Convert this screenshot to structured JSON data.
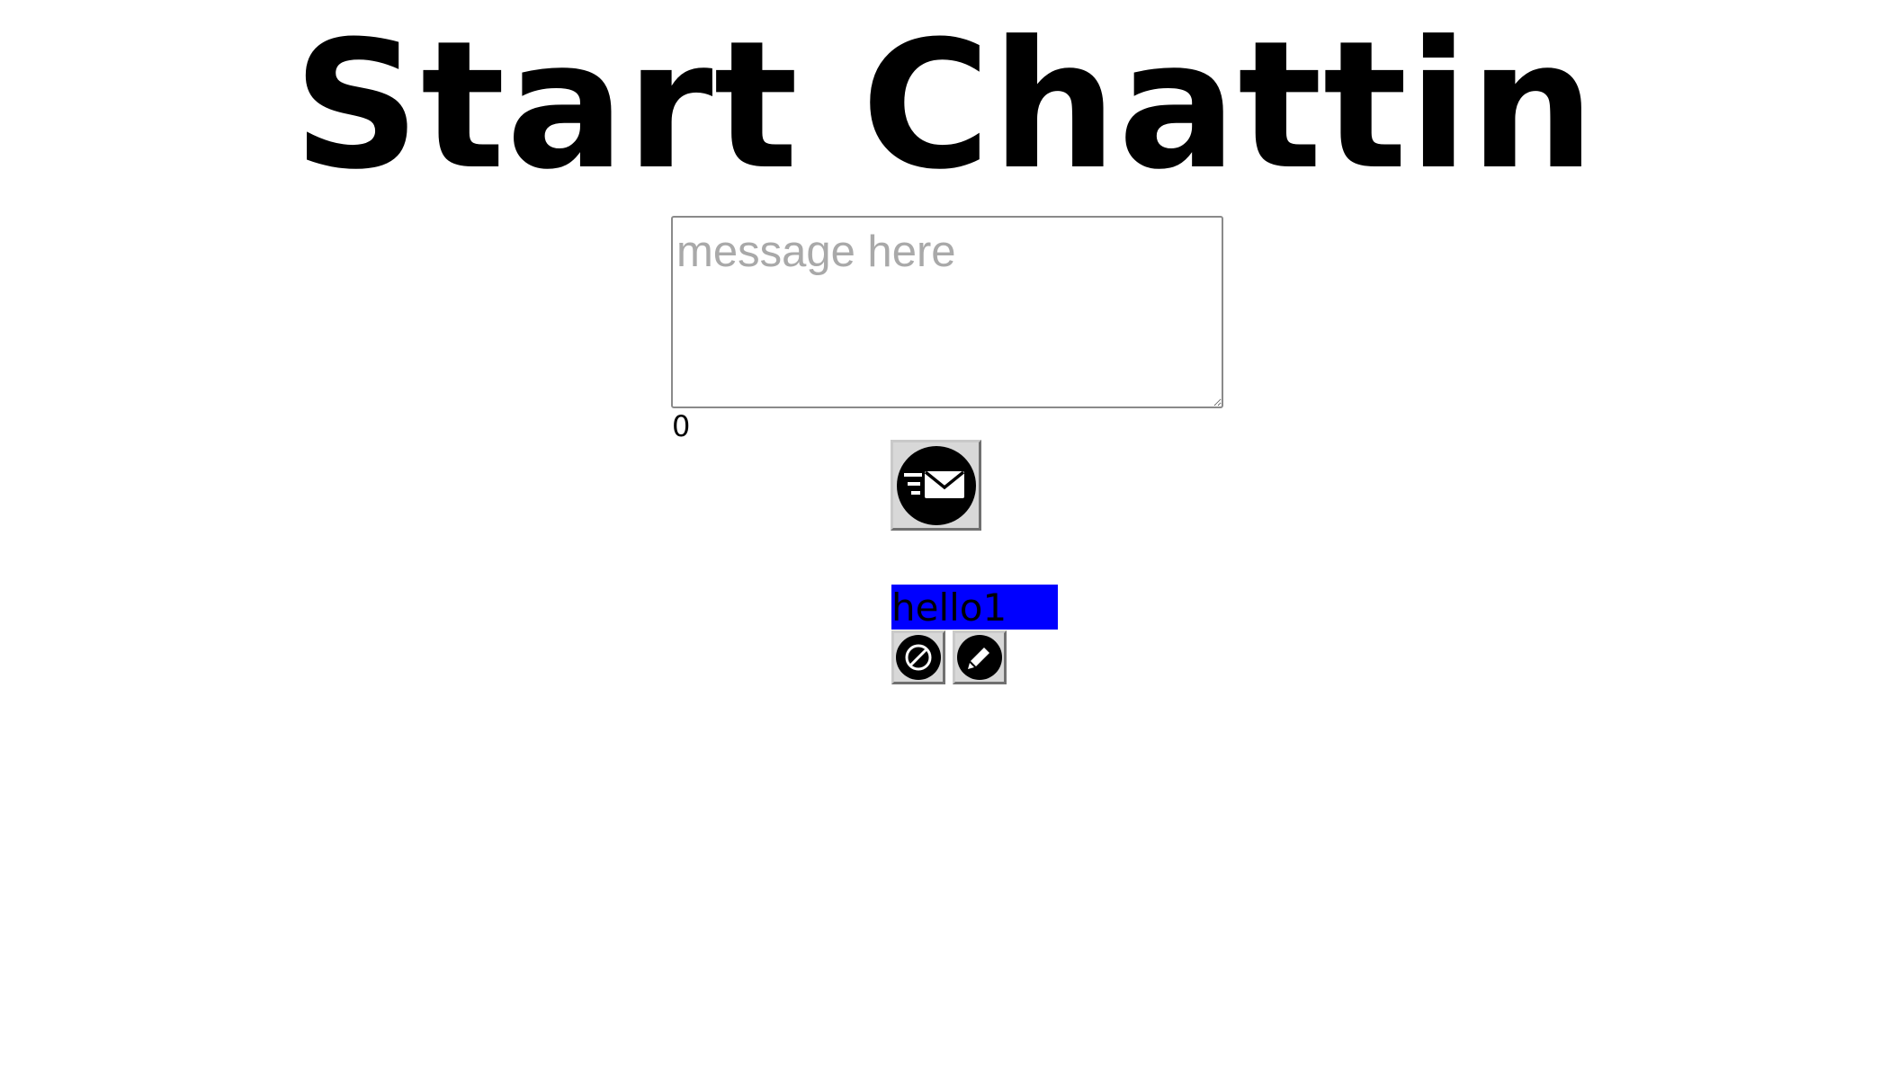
{
  "page": {
    "title": "Start Chattin"
  },
  "composer": {
    "placeholder": "message here",
    "value": "",
    "char_count": "0"
  },
  "send_button": {
    "icon": "send-mail-icon"
  },
  "messages": [
    {
      "text": "hello1",
      "highlight_color": "#0000ff",
      "actions": [
        {
          "icon": "cancel-icon"
        },
        {
          "icon": "pencil-edit-icon"
        }
      ]
    }
  ]
}
